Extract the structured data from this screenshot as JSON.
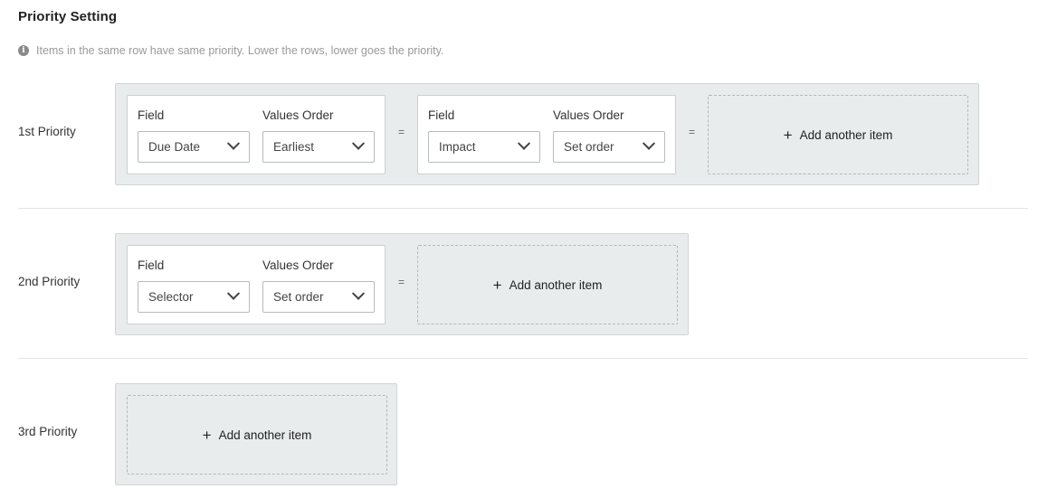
{
  "header": {
    "title": "Priority Setting",
    "hint": "Items in the same row have same priority. Lower the rows, lower goes the priority.",
    "hint_icon": "info-icon"
  },
  "labels": {
    "field": "Field",
    "values_order": "Values Order",
    "equals": "=",
    "add_item": "Add another item",
    "plus": "+"
  },
  "rows": [
    {
      "label": "1st Priority",
      "items": [
        {
          "field": "Due Date",
          "order": "Earliest"
        },
        {
          "field": "Impact",
          "order": "Set order"
        }
      ]
    },
    {
      "label": "2nd Priority",
      "items": [
        {
          "field": "Selector",
          "order": "Set order"
        }
      ]
    },
    {
      "label": "3rd Priority",
      "items": []
    }
  ],
  "colors": {
    "group_bg": "#e9ecec",
    "border": "#d2d5d5",
    "text": "#333333",
    "hint": "#9a9a9a"
  }
}
